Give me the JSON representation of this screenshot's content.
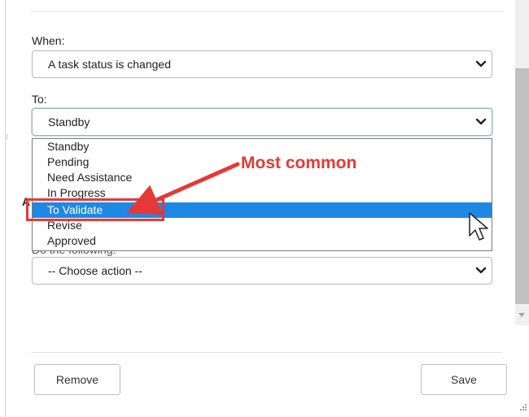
{
  "when": {
    "label": "When:",
    "selected": "A task status is changed"
  },
  "to": {
    "label": "To:",
    "selected": "Standby",
    "options": [
      "Standby",
      "Pending",
      "Need Assistance",
      "In Progress",
      "To Validate",
      "Revise",
      "Approved"
    ],
    "highlighted_option": "To Validate"
  },
  "obscured": {
    "section_initial": "A",
    "do_label": "Do the following:"
  },
  "action": {
    "selected": "-- Choose action --"
  },
  "buttons": {
    "remove": "Remove",
    "save": "Save"
  },
  "annotation": {
    "text": "Most common",
    "color": "#e53935"
  },
  "colors": {
    "highlight": "#1e88e5"
  },
  "icons": {
    "select_chevron": "chevron-down-icon",
    "cursor": "mouse-pointer-icon",
    "resize": "resize-grip-icon"
  }
}
